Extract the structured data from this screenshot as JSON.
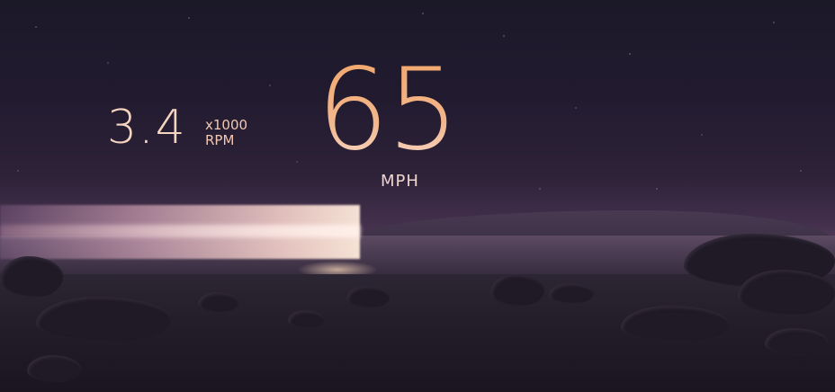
{
  "dashboard": {
    "rpm": {
      "value": "3.4",
      "multiplier": "x1000",
      "unit": "RPM"
    },
    "speed": {
      "value": "65",
      "unit": "MPH"
    }
  },
  "colors": {
    "accent_orange": "#f2a469",
    "text_peach": "#f6d5c0",
    "sky_dark": "#1b1828"
  }
}
